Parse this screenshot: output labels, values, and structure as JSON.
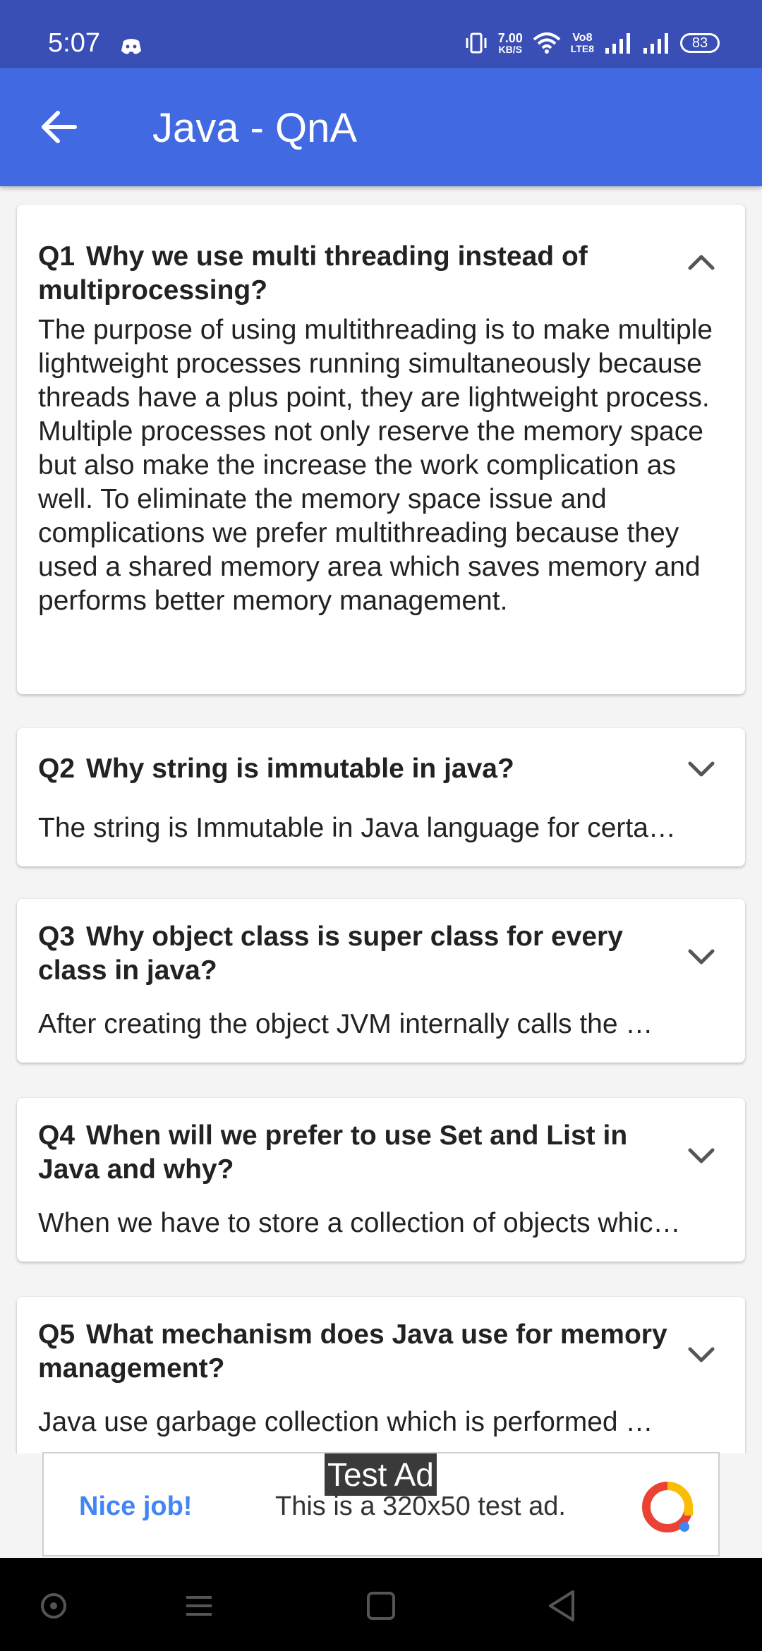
{
  "status_bar": {
    "time": "5:07",
    "net_speed_value": "7.00",
    "net_speed_unit": "KB/S",
    "volte_top": "Vo8",
    "volte_bottom": "LTE8",
    "battery": "83"
  },
  "app_bar": {
    "title": "Java - QnA"
  },
  "questions": [
    {
      "num": "Q1",
      "question": "Why we use multi threading instead of multiprocessing?",
      "answer": "The purpose of using multithreading is to make multiple lightweight processes running simultaneously because threads have a plus point, they are lightweight process. Multiple processes not only reserve the memory space but also make the increase the work complication as well. To eliminate the memory space issue and complications we prefer multithreading because they used a shared memory area which saves memory and performs better memory management.",
      "expanded": true
    },
    {
      "num": "Q2",
      "question": "Why string is immutable in java?",
      "answer": "The string is Immutable in Java language for certa…",
      "expanded": false
    },
    {
      "num": "Q3",
      "question": "Why object class is super class for every class in java?",
      "answer": "After creating the object JVM internally calls the …",
      "expanded": false
    },
    {
      "num": "Q4",
      "question": "When will we prefer to use Set and List in Java and why?",
      "answer": "When we have to store a collection of objects whic…",
      "expanded": false
    },
    {
      "num": "Q5",
      "question": "What mechanism does Java use for memory management?",
      "answer": "Java use garbage collection which is performed …",
      "expanded": false
    }
  ],
  "ad": {
    "tag": "Test Ad",
    "headline": "Nice job!",
    "message": "This is a 320x50 test ad."
  },
  "colors": {
    "status_bar": "#3a4fb5",
    "app_bar": "#4169e1",
    "ad_link": "#4285f4"
  }
}
